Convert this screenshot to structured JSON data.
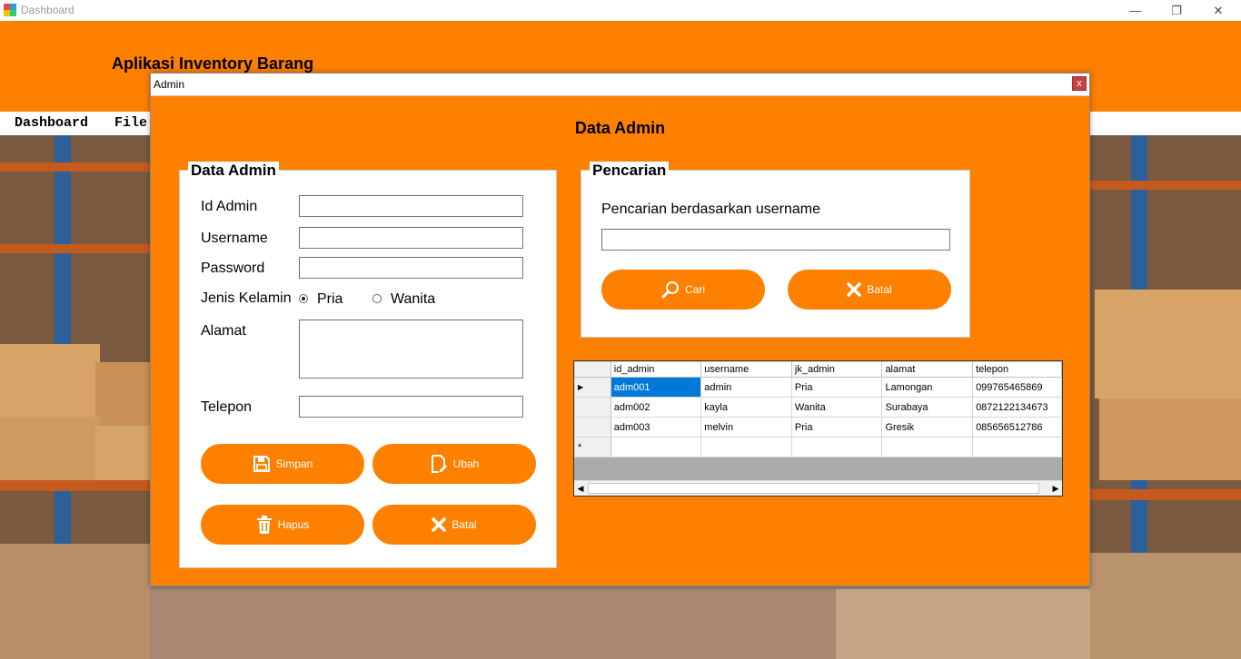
{
  "window": {
    "title": "Dashboard",
    "controls": {
      "minimize": "—",
      "restore": "❐",
      "close": "✕"
    }
  },
  "header": {
    "app_title": "Aplikasi Inventory Barang"
  },
  "menu": [
    {
      "label": "Dashboard"
    },
    {
      "label": "File"
    }
  ],
  "dialog": {
    "title": "Admin",
    "close_label": "x",
    "heading": "Data Admin",
    "form": {
      "legend": "Data Admin",
      "id_label": "Id Admin",
      "id_value": "",
      "username_label": "Username",
      "username_value": "",
      "password_label": "Password",
      "password_value": "",
      "gender_label": "Jenis Kelamin",
      "gender_options": [
        {
          "label": "Pria",
          "checked": true
        },
        {
          "label": "Wanita",
          "checked": false
        }
      ],
      "alamat_label": "Alamat",
      "alamat_value": "",
      "telepon_label": "Telepon",
      "telepon_value": "",
      "buttons": {
        "simpan": "Simpan",
        "ubah": "Ubah",
        "hapus": "Hapus",
        "batal": "Batal"
      }
    },
    "search": {
      "legend": "Pencarian",
      "label": "Pencarian berdasarkan username",
      "value": "",
      "cari_label": "Cari",
      "batal_label": "Batal"
    },
    "grid": {
      "columns": [
        "id_admin",
        "username",
        "jk_admin",
        "alamat",
        "telepon"
      ],
      "rows": [
        [
          "adm001",
          "admin",
          "Pria",
          "Lamongan",
          "099765465869"
        ],
        [
          "adm002",
          "kayla",
          "Wanita",
          "Surabaya",
          "0872122134673"
        ],
        [
          "adm003",
          "melvin",
          "Pria",
          "Gresik",
          "085656512786"
        ]
      ],
      "current_row_marker": "▶",
      "new_row_marker": "*",
      "scroll_left": "◀",
      "scroll_right": "▶"
    }
  },
  "colors": {
    "accent": "#fe8001",
    "selection": "#0078d7"
  }
}
